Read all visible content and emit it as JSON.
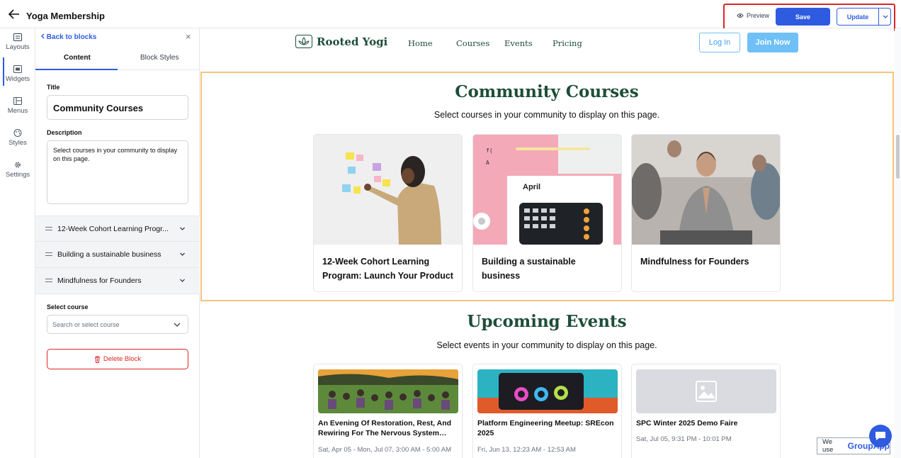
{
  "header": {
    "title": "Yoga Membership",
    "preview_label": "Preview",
    "save_label": "Save",
    "update_label": "Update"
  },
  "rail": {
    "items": [
      {
        "label": "Layouts",
        "icon": "layouts-icon"
      },
      {
        "label": "Widgets",
        "icon": "widgets-icon"
      },
      {
        "label": "Menus",
        "icon": "menus-icon"
      },
      {
        "label": "Styles",
        "icon": "palette-icon"
      },
      {
        "label": "Settings",
        "icon": "gear-icon"
      }
    ]
  },
  "panel": {
    "back_label": "Back to blocks",
    "tabs": [
      "Content",
      "Block Styles"
    ],
    "title_label": "Title",
    "title_value": "Community Courses",
    "description_label": "Description",
    "description_value": "Select courses in your community to display on this page.",
    "courses": [
      "12-Week Cohort Learning Progr...",
      "Building a sustainable business",
      "Mindfulness for Founders"
    ],
    "select_label": "Select course",
    "select_placeholder": "Search or select course",
    "delete_label": "Delete Block"
  },
  "site": {
    "logo": "Rooted Yogi",
    "nav": [
      "Home",
      "Courses",
      "Events",
      "Pricing"
    ],
    "login": "Log In",
    "join": "Join Now"
  },
  "courses_section": {
    "title": "Community Courses",
    "description": "Select courses in your community to display on this page.",
    "cards": [
      {
        "title": "12-Week Cohort Learning Program: Launch Your Product"
      },
      {
        "title": "Building a sustainable business",
        "image_text": "April"
      },
      {
        "title": "Mindfulness for Founders"
      }
    ]
  },
  "events_section": {
    "title": "Upcoming Events",
    "description": "Select events in your community to display on this page.",
    "cards": [
      {
        "title": "An Evening Of Restoration, Rest, And Rewiring For The Nervous System…",
        "date": "Sat, Apr 05 - Mon, Jul 07, 3:00 AM - 5:00 AM"
      },
      {
        "title": "Platform Engineering Meetup: SREcon 2025",
        "date": "Fri, Jun 13, 12:23 AM - 12:53 AM"
      },
      {
        "title": "SPC Winter 2025 Demo Faire",
        "date": "Sat, Jul 05, 9:31 PM - 10:01 PM"
      }
    ]
  },
  "badge": {
    "prefix": "We use",
    "brand": "GroupApp"
  },
  "colors": {
    "accent": "#2f5be0",
    "brand_green": "#1e4d3a",
    "highlight_red": "#dc2626",
    "selection_orange": "#f6c37d"
  }
}
